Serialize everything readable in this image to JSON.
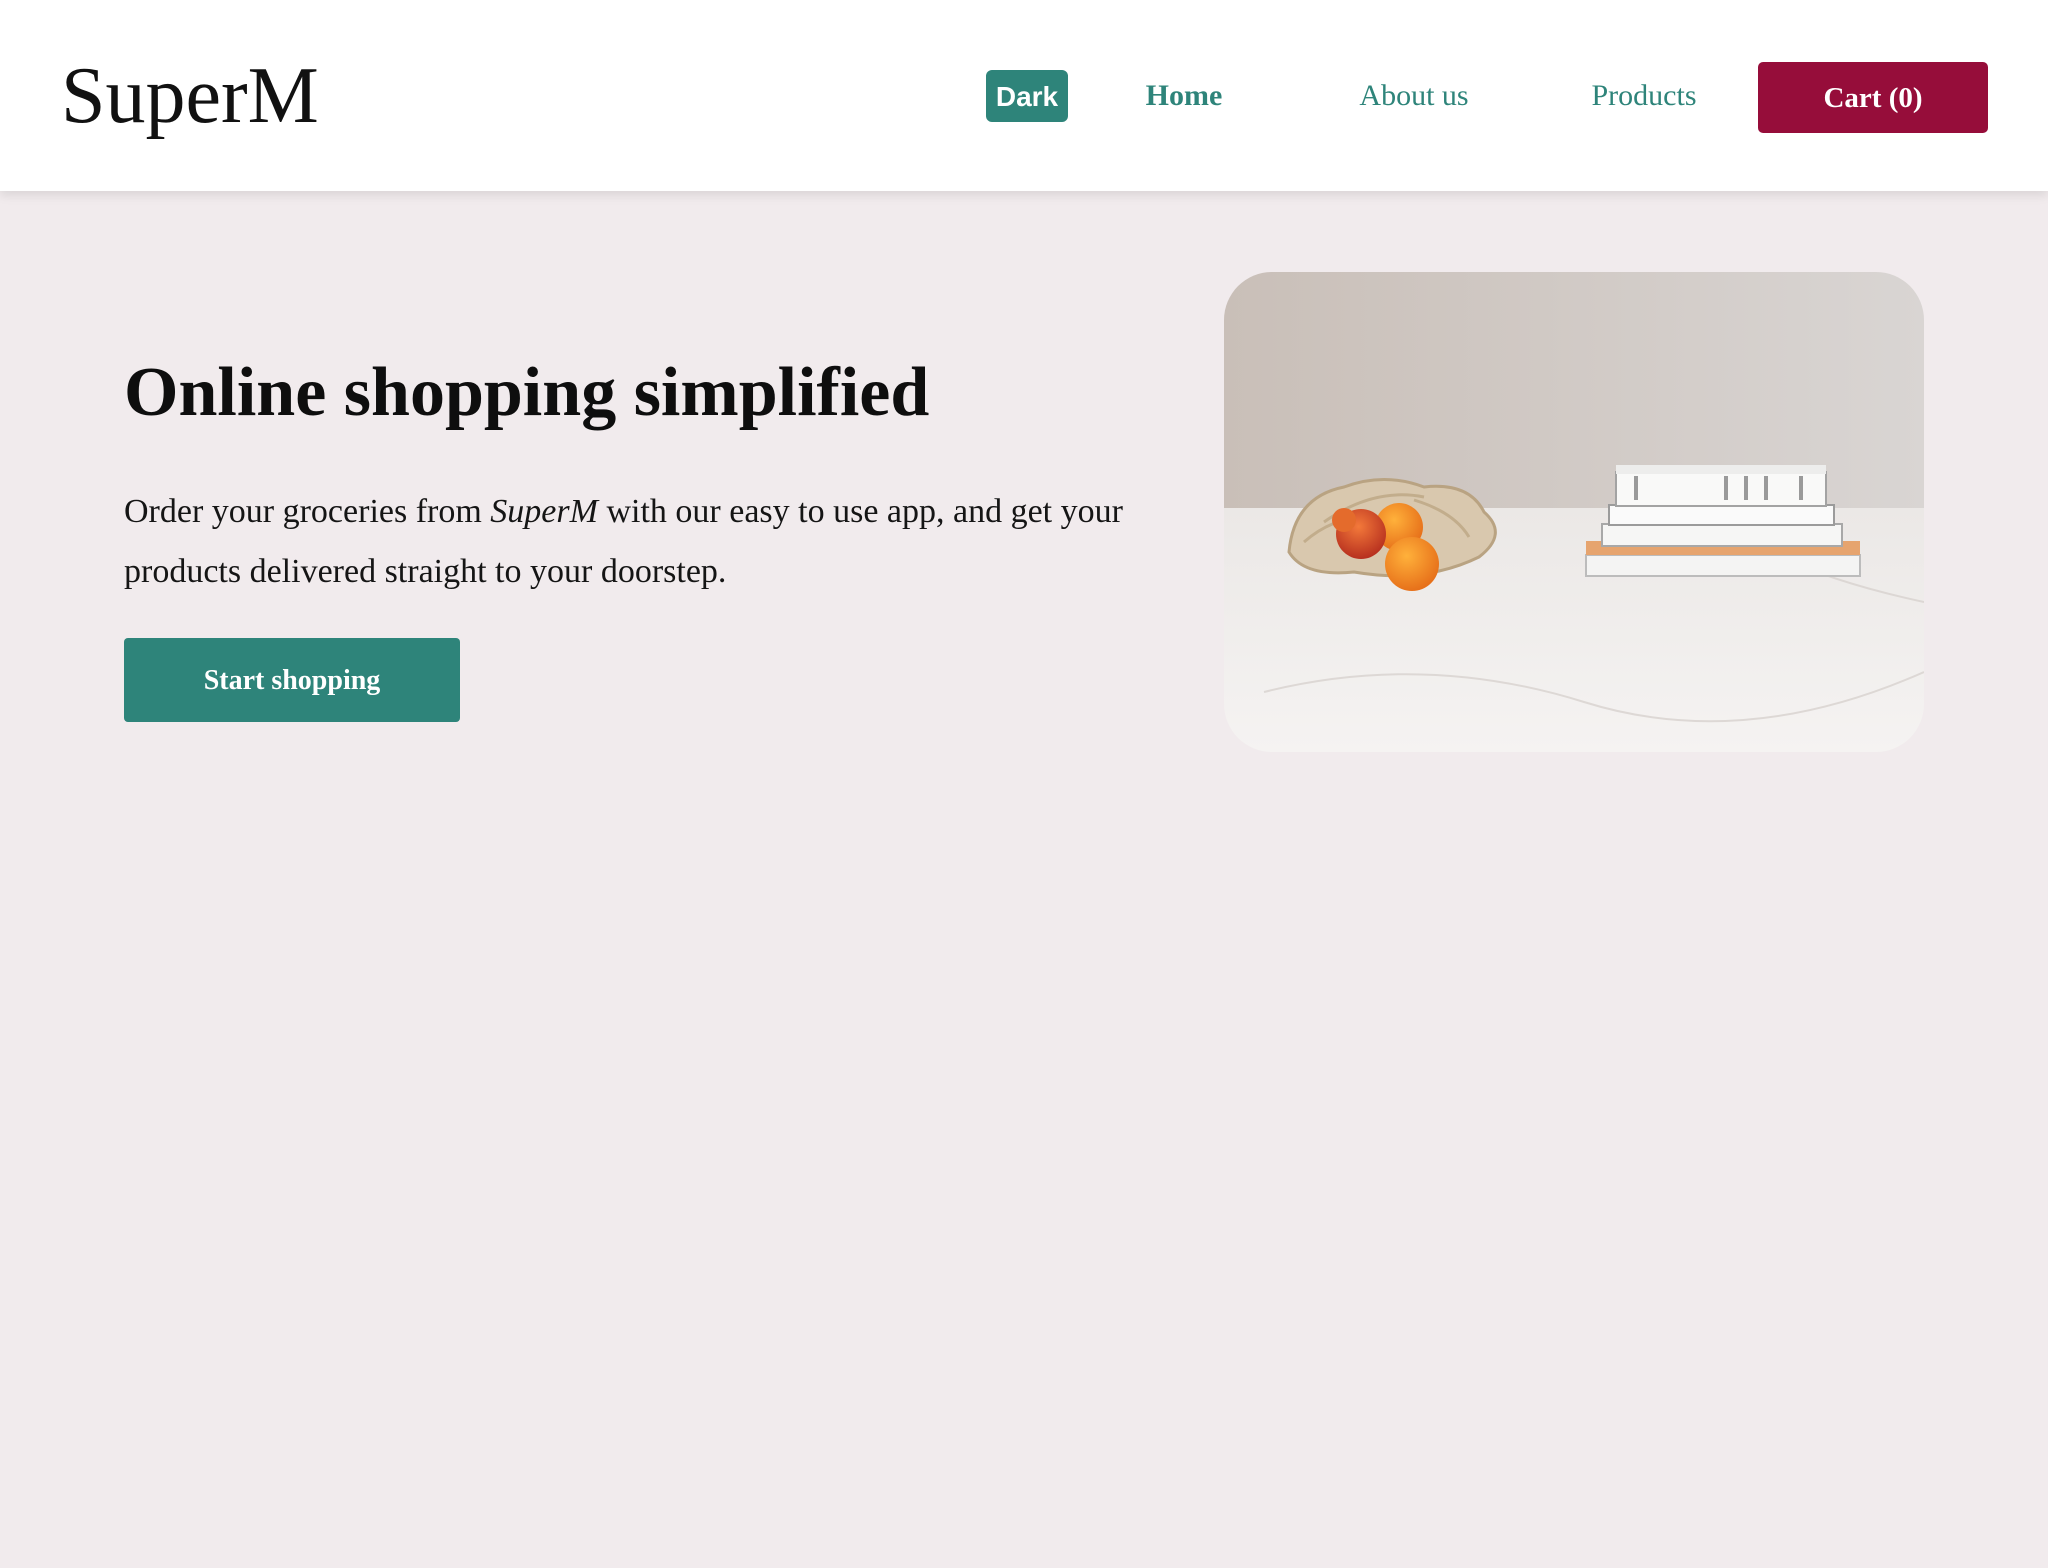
{
  "header": {
    "brand": "SuperM",
    "theme_toggle_label": "Dark",
    "nav": {
      "home": "Home",
      "about": "About us",
      "products": "Products"
    },
    "cart_label": "Cart (0)"
  },
  "hero": {
    "title": "Online shopping simplified",
    "text_before": "Order your groceries from ",
    "text_brand": "SuperM",
    "text_after": " with our easy to use app, and get your products delivered straight to your doorstep.",
    "cta_label": "Start shopping"
  },
  "colors": {
    "accent": "#2e847a",
    "cart": "#960d3a",
    "page_bg": "#f1ebed",
    "header_bg": "#ffffff"
  }
}
